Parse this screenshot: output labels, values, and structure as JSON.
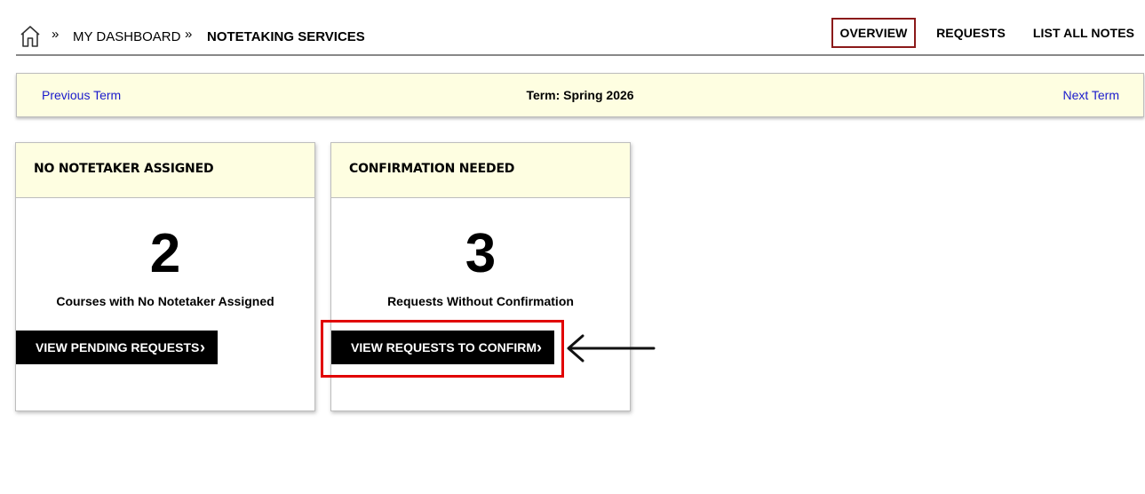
{
  "breadcrumb": {
    "items": [
      "My Dashboard",
      "Notetaking Services"
    ]
  },
  "nav": {
    "tabs": [
      {
        "label": "OVERVIEW",
        "active": true
      },
      {
        "label": "REQUESTS",
        "active": false
      },
      {
        "label": "LIST ALL NOTES",
        "active": false
      }
    ]
  },
  "term": {
    "previous_label": "Previous Term",
    "title": "Term: Spring 2026",
    "next_label": "Next Term"
  },
  "cards": [
    {
      "header": "NO NOTETAKER ASSIGNED",
      "count": "2",
      "label": "Courses with No Notetaker Assigned",
      "button": "VIEW PENDING REQUESTS"
    },
    {
      "header": "CONFIRMATION NEEDED",
      "count": "3",
      "label": "Requests Without Confirmation",
      "button": "VIEW REQUESTS TO CONFIRM"
    }
  ],
  "icons": {
    "home": "home-icon",
    "breadcrumb_separator": "double-chevron-right-icon",
    "button_arrow": "chevron-right-icon"
  },
  "colors": {
    "panel_background": "#fefee1",
    "active_tab_border": "#8b1a1a",
    "link": "#1a1acc",
    "highlight": "#e10000",
    "button_background": "#000000"
  }
}
